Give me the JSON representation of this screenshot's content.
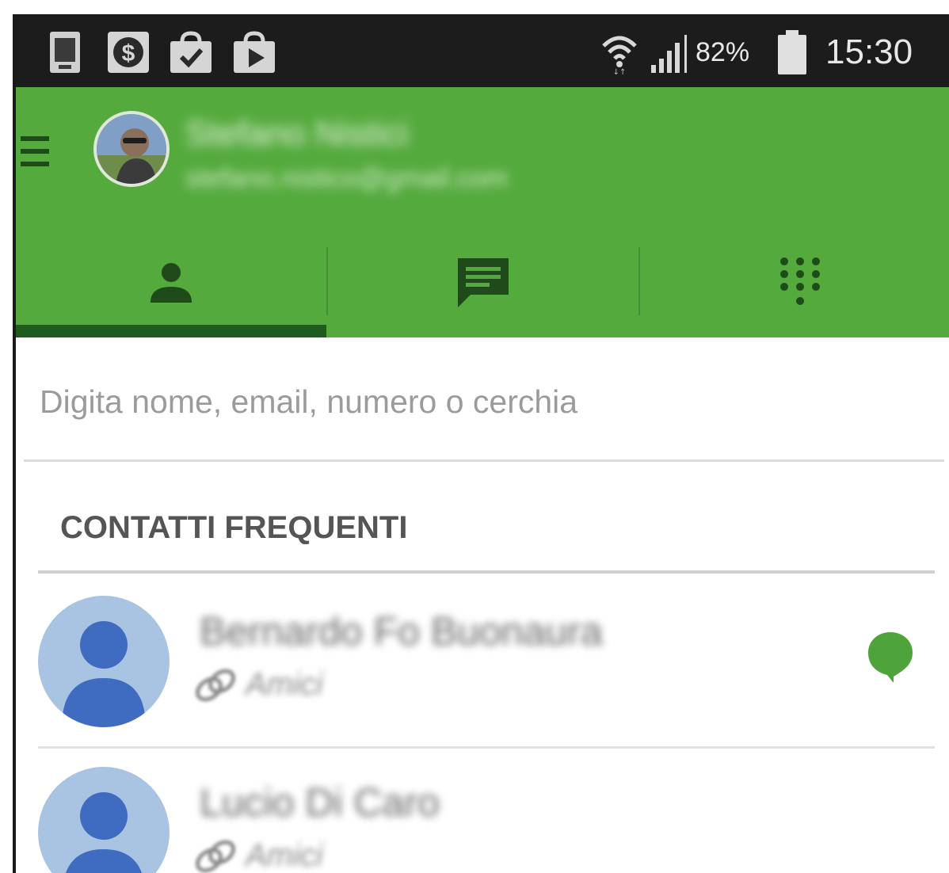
{
  "status_bar": {
    "battery_percent": "82%",
    "time": "15:30",
    "notification_icons": [
      "phone-icon",
      "money-icon",
      "shopping-bag-check-icon",
      "play-store-bag-icon"
    ],
    "system_icons": [
      "wifi-icon",
      "signal-icon",
      "battery-icon"
    ]
  },
  "header": {
    "background_color": "#55aa3e",
    "user_name": "Stefano Nistici",
    "user_email": "stefano.nistico@gmail.com",
    "tabs": [
      {
        "icon": "person-icon",
        "selected": true
      },
      {
        "icon": "chat-bubble-icon",
        "selected": false
      },
      {
        "icon": "dialpad-icon",
        "selected": false
      }
    ]
  },
  "search": {
    "placeholder": "Digita nome, email, numero o cerchia",
    "value": ""
  },
  "frequent_contacts": {
    "header": "CONTATTI FREQUENTI",
    "items": [
      {
        "name": "Bernardo Fo Buonaura",
        "circle": "Amici",
        "has_hangout": true
      },
      {
        "name": "Lucio Di Caro",
        "circle": "Amici",
        "has_hangout": false
      }
    ]
  },
  "colors": {
    "accent_green": "#55aa3e",
    "tab_indicator": "#1f5a1e",
    "avatar_bg": "#a9c3e3",
    "avatar_fg": "#3f6cc1",
    "hangout_green": "#4ea33a"
  }
}
